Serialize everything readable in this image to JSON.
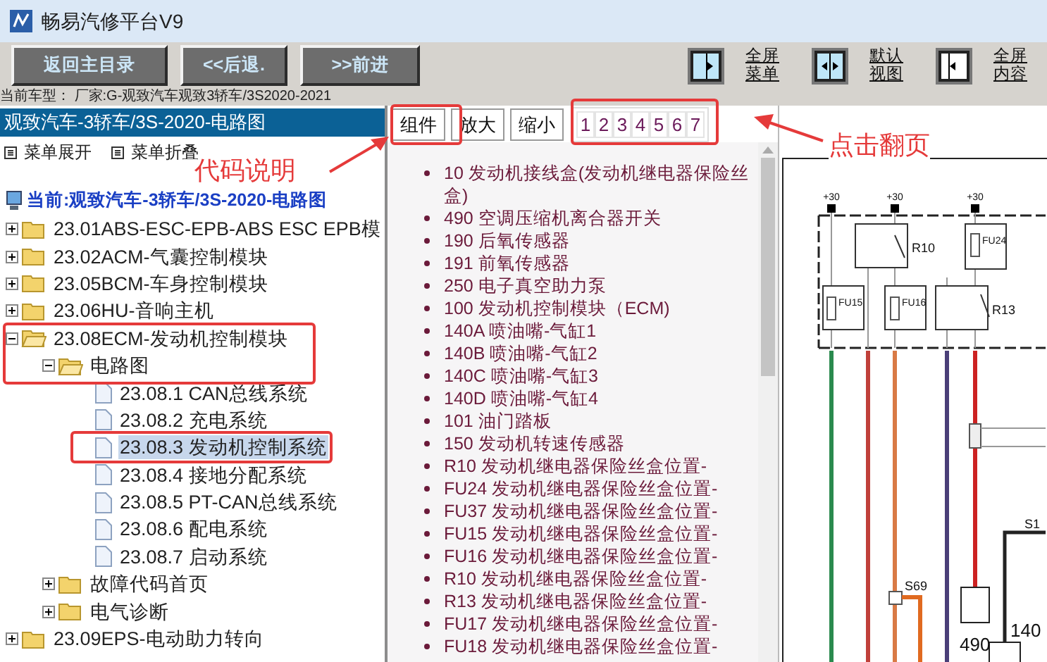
{
  "window": {
    "title": "畅易汽修平台V9"
  },
  "toolbar": {
    "nav_buttons": [
      "返回主目录",
      "<<后退.",
      ">>前进"
    ],
    "view_buttons": [
      {
        "kind": "menu",
        "lines": [
          "全屏",
          "菜单"
        ]
      },
      {
        "kind": "default",
        "lines": [
          "默认",
          "视图"
        ]
      },
      {
        "kind": "content",
        "lines": [
          "全屏",
          "内容"
        ]
      }
    ]
  },
  "vehicle_line": "当前车型： 厂家:G-观致汽车观致3轿车/3S2020-2021",
  "sidebar": {
    "header": "观致汽车-3轿车/3S-2020-电路图",
    "actions": [
      "菜单展开",
      "菜单折叠"
    ],
    "current": "当前:观致汽车-3轿车/3S-2020-电路图",
    "tree": [
      {
        "label": "23.01ABS-ESC-EPB-ABS ESC EPB模",
        "kind": "folder",
        "expanded": false
      },
      {
        "label": "23.02ACM-气囊控制模块",
        "kind": "folder",
        "expanded": false
      },
      {
        "label": "23.05BCM-车身控制模块",
        "kind": "folder",
        "expanded": false
      },
      {
        "label": "23.06HU-音响主机",
        "kind": "folder",
        "expanded": false
      },
      {
        "label": "23.08ECM-发动机控制模块",
        "kind": "folder",
        "expanded": true,
        "children": [
          {
            "label": "电路图",
            "kind": "folder",
            "expanded": true,
            "children": [
              {
                "label": "23.08.1 CAN总线系统",
                "kind": "page",
                "selected": false
              },
              {
                "label": "23.08.2 充电系统",
                "kind": "page",
                "selected": false
              },
              {
                "label": "23.08.3 发动机控制系统",
                "kind": "page",
                "selected": true
              },
              {
                "label": "23.08.4 接地分配系统",
                "kind": "page",
                "selected": false
              },
              {
                "label": "23.08.5 PT-CAN总线系统",
                "kind": "page",
                "selected": false
              },
              {
                "label": "23.08.6 配电系统",
                "kind": "page",
                "selected": false
              },
              {
                "label": "23.08.7 启动系统",
                "kind": "page",
                "selected": false
              }
            ]
          },
          {
            "label": "故障代码首页",
            "kind": "folder",
            "expanded": false
          },
          {
            "label": "电气诊断",
            "kind": "folder",
            "expanded": false
          }
        ]
      },
      {
        "label": "23.09EPS-电动助力转向",
        "kind": "folder",
        "expanded": false
      }
    ]
  },
  "content": {
    "buttons": [
      "组件",
      "放大",
      "缩小"
    ],
    "pages": [
      "1",
      "2",
      "3",
      "4",
      "5",
      "6",
      "7"
    ],
    "components": [
      "10 发动机接线盒(发动机继电器保险丝盒)",
      "490 空调压缩机离合器开关",
      "190 后氧传感器",
      "191 前氧传感器",
      "250 电子真空助力泵",
      "100 发动机控制模块（ECM)",
      "140A 喷油嘴-气缸1",
      "140B 喷油嘴-气缸2",
      "140C 喷油嘴-气缸3",
      "140D 喷油嘴-气缸4",
      "101 油门踏板",
      "150 发动机转速传感器",
      "R10 发动机继电器保险丝盒位置-",
      "FU24 发动机继电器保险丝盒位置-",
      "FU37 发动机继电器保险丝盒位置-",
      "FU15 发动机继电器保险丝盒位置-",
      "FU16 发动机继电器保险丝盒位置-",
      "R10 发动机继电器保险丝盒位置-",
      "R13 发动机继电器保险丝盒位置-",
      "FU17 发动机继电器保险丝盒位置-",
      "FU18 发动机继电器保险丝盒位置-"
    ]
  },
  "diagram": {
    "labels": [
      "+30",
      "+30",
      "+30",
      "R10",
      "FU24",
      "FU15",
      "FU16",
      "R13",
      "S69",
      "490",
      "140",
      "S1"
    ]
  },
  "annotations": [
    "代码说明",
    "点击翻页"
  ]
}
